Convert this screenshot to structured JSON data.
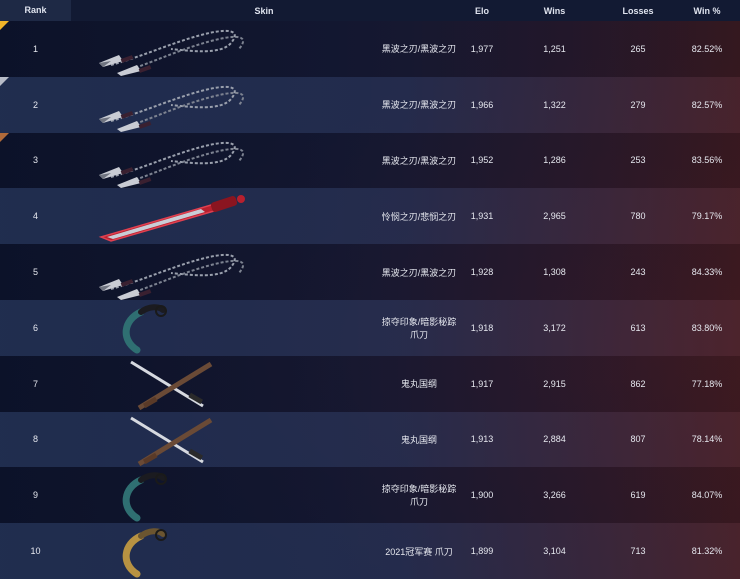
{
  "header": {
    "rank": "Rank",
    "skin": "Skin",
    "elo": "Elo",
    "wins": "Wins",
    "losses": "Losses",
    "win_pct": "Win %"
  },
  "rows": [
    {
      "rank": "1",
      "skin": "黑波之刃/黑波之刃",
      "elo": "1,977",
      "wins": "1,251",
      "losses": "265",
      "win_pct": "82.52%",
      "medal": "gold",
      "icon": "kunai-chain-icon"
    },
    {
      "rank": "2",
      "skin": "黑波之刃/黑波之刃",
      "elo": "1,966",
      "wins": "1,322",
      "losses": "279",
      "win_pct": "82.57%",
      "medal": "silver",
      "icon": "kunai-chain-icon"
    },
    {
      "rank": "3",
      "skin": "黑波之刃/黑波之刃",
      "elo": "1,952",
      "wins": "1,286",
      "losses": "253",
      "win_pct": "83.56%",
      "medal": "bronze",
      "icon": "kunai-chain-icon"
    },
    {
      "rank": "4",
      "skin": "怜悯之刃/悲悯之刃",
      "elo": "1,931",
      "wins": "2,965",
      "losses": "780",
      "win_pct": "79.17%",
      "medal": "",
      "icon": "red-dagger-icon"
    },
    {
      "rank": "5",
      "skin": "黑波之刃/黑波之刃",
      "elo": "1,928",
      "wins": "1,308",
      "losses": "243",
      "win_pct": "84.33%",
      "medal": "",
      "icon": "kunai-chain-icon"
    },
    {
      "rank": "6",
      "skin": "掠夺印象/暗影秘踪 爪刀",
      "elo": "1,918",
      "wins": "3,172",
      "losses": "613",
      "win_pct": "83.80%",
      "medal": "",
      "icon": "karambit-icon"
    },
    {
      "rank": "7",
      "skin": "鬼丸国纲",
      "elo": "1,917",
      "wins": "2,915",
      "losses": "862",
      "win_pct": "77.18%",
      "medal": "",
      "icon": "crossed-katana-icon"
    },
    {
      "rank": "8",
      "skin": "鬼丸国纲",
      "elo": "1,913",
      "wins": "2,884",
      "losses": "807",
      "win_pct": "78.14%",
      "medal": "",
      "icon": "crossed-katana-icon"
    },
    {
      "rank": "9",
      "skin": "掠夺印象/暗影秘踪 爪刀",
      "elo": "1,900",
      "wins": "3,266",
      "losses": "619",
      "win_pct": "84.07%",
      "medal": "",
      "icon": "karambit-icon"
    },
    {
      "rank": "10",
      "skin": "2021冠军赛 爪刀",
      "elo": "1,899",
      "wins": "3,104",
      "losses": "713",
      "win_pct": "81.32%",
      "medal": "",
      "icon": "gold-karambit-icon"
    }
  ]
}
